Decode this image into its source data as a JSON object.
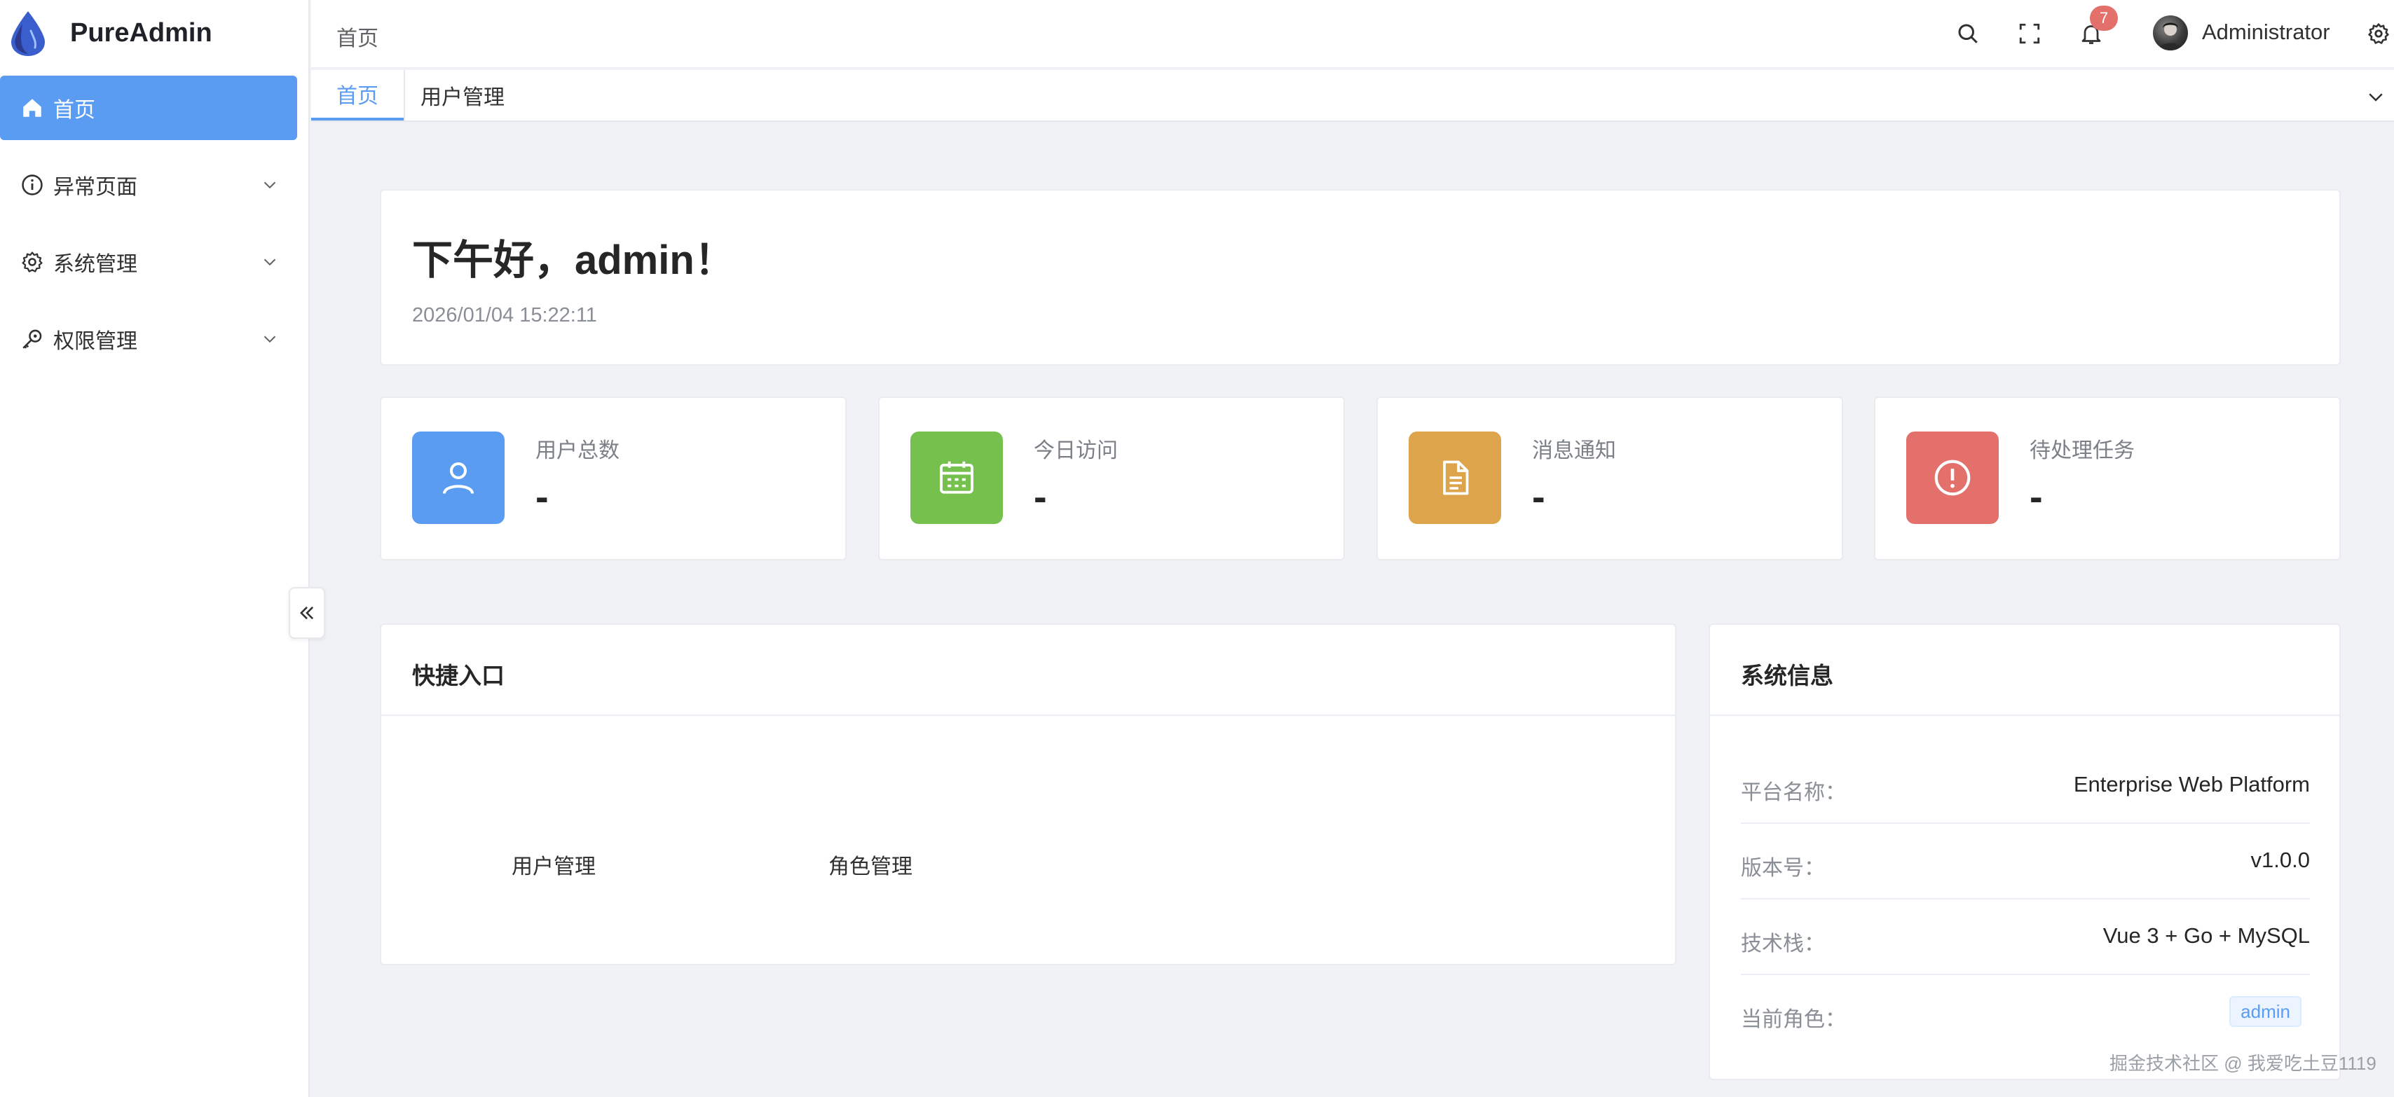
{
  "app": {
    "brand": "PureAdmin"
  },
  "sidebar": {
    "items": [
      {
        "label": "首页",
        "icon": "home-icon",
        "active": true,
        "expandable": false
      },
      {
        "label": "异常页面",
        "icon": "info-circle-icon",
        "active": false,
        "expandable": true
      },
      {
        "label": "系统管理",
        "icon": "gear-icon",
        "active": false,
        "expandable": true
      },
      {
        "label": "权限管理",
        "icon": "key-icon",
        "active": false,
        "expandable": true
      }
    ]
  },
  "header": {
    "breadcrumb": "首页",
    "notification_count": "7",
    "user_name": "Administrator",
    "icons": [
      "search-icon",
      "fullscreen-icon",
      "bell-icon",
      "settings-icon"
    ]
  },
  "tabs": [
    {
      "label": "首页",
      "active": true
    },
    {
      "label": "用户管理",
      "active": false
    }
  ],
  "greeting": {
    "title": "下午好，admin！",
    "datetime": "2026/01/04 15:22:11"
  },
  "stats": [
    {
      "label": "用户总数",
      "value": "-",
      "color": "#5b9cf3",
      "icon": "user-icon"
    },
    {
      "label": "今日访问",
      "value": "-",
      "color": "#76c04e",
      "icon": "calendar-icon"
    },
    {
      "label": "消息通知",
      "value": "-",
      "color": "#dda44c",
      "icon": "document-icon"
    },
    {
      "label": "待处理任务",
      "value": "-",
      "color": "#e3706a",
      "icon": "alert-circle-icon"
    }
  ],
  "quick_entry": {
    "title": "快捷入口",
    "links": [
      "用户管理",
      "角色管理"
    ]
  },
  "system_info": {
    "title": "系统信息",
    "rows": [
      {
        "key": "平台名称：",
        "value": "Enterprise Web Platform"
      },
      {
        "key": "版本号：",
        "value": "v1.0.0"
      },
      {
        "key": "技术栈：",
        "value": "Vue 3 + Go + MySQL"
      },
      {
        "key": "当前角色：",
        "value": "admin"
      }
    ]
  },
  "watermark": "掘金技术社区 @ 我爱吃土豆1119",
  "colors": {
    "primary": "#5b9cf3",
    "badge": "#e3706a",
    "background": "#f0f2f5"
  }
}
